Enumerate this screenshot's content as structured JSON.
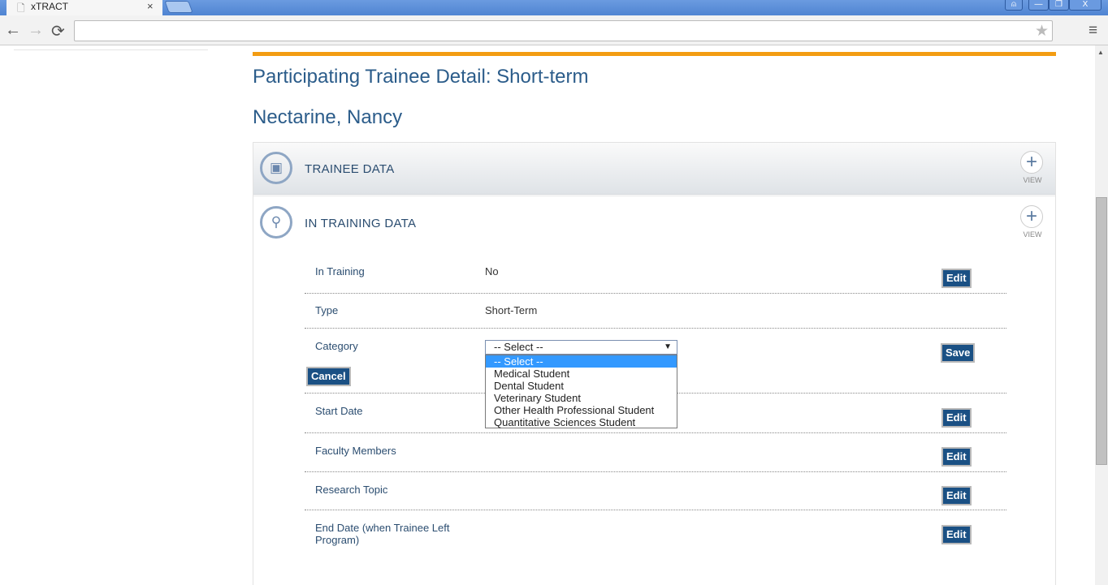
{
  "browser": {
    "tab_title": "xTRACT",
    "tab_close": "×",
    "url": "",
    "window_controls": {
      "user": "⍝",
      "minimize": "—",
      "restore": "❐",
      "close": "X"
    },
    "back": "←",
    "forward": "→",
    "reload": "⟳",
    "star": "★",
    "menu": "≡"
  },
  "page": {
    "title": "Participating Trainee Detail: Short-term",
    "trainee_name": "Nectarine, Nancy"
  },
  "sections": [
    {
      "title": "TRAINEE DATA",
      "icon": "id-card-icon",
      "view_label": "VIEW",
      "plus": "+"
    },
    {
      "title": "IN TRAINING DATA",
      "icon": "location-pin-icon",
      "view_label": "VIEW",
      "plus": "+"
    }
  ],
  "rows": {
    "in_training": {
      "label": "In Training",
      "value": "No",
      "button": "Edit"
    },
    "type": {
      "label": "Type",
      "value": "Short-Term"
    },
    "category": {
      "label": "Category",
      "selected": "-- Select --",
      "save": "Save",
      "cancel": "Cancel",
      "options": [
        "-- Select --",
        "Medical Student",
        "Dental Student",
        "Veterinary Student",
        "Other Health Professional Student",
        "Quantitative Sciences Student"
      ]
    },
    "start_date": {
      "label": "Start Date",
      "button": "Edit"
    },
    "faculty": {
      "label": "Faculty Members",
      "button": "Edit"
    },
    "research": {
      "label": "Research Topic",
      "button": "Edit"
    },
    "end_date": {
      "label": "End Date (when Trainee Left Program)",
      "button": "Edit"
    }
  }
}
